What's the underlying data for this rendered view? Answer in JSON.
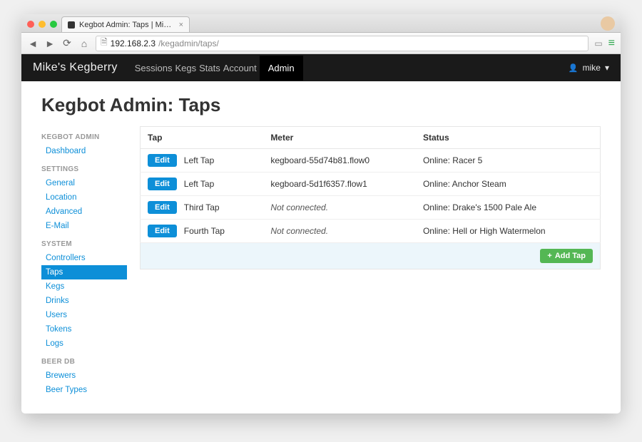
{
  "browser": {
    "tab_title": "Kegbot Admin: Taps | Mik…",
    "url_host": "192.168.2.3",
    "url_path": "/kegadmin/taps/"
  },
  "navbar": {
    "brand": "Mike's Kegberry",
    "items": [
      "Sessions",
      "Kegs",
      "Stats",
      "Account",
      "Admin"
    ],
    "active_index": 4,
    "user": "mike"
  },
  "page": {
    "title": "Kegbot Admin: Taps"
  },
  "sidebar": {
    "groups": [
      {
        "title": "KEGBOT ADMIN",
        "items": [
          "Dashboard"
        ]
      },
      {
        "title": "SETTINGS",
        "items": [
          "General",
          "Location",
          "Advanced",
          "E-Mail"
        ]
      },
      {
        "title": "SYSTEM",
        "items": [
          "Controllers",
          "Taps",
          "Kegs",
          "Drinks",
          "Users",
          "Tokens",
          "Logs"
        ]
      },
      {
        "title": "BEER DB",
        "items": [
          "Brewers",
          "Beer Types"
        ]
      }
    ],
    "active": "Taps"
  },
  "table": {
    "edit_label": "Edit",
    "add_label": "Add Tap",
    "columns": [
      "Tap",
      "Meter",
      "Status"
    ],
    "rows": [
      {
        "tap": "Left Tap",
        "meter": "kegboard-55d74b81.flow0",
        "meter_italic": false,
        "status": "Online: Racer 5"
      },
      {
        "tap": "Left Tap",
        "meter": "kegboard-5d1f6357.flow1",
        "meter_italic": false,
        "status": "Online: Anchor Steam"
      },
      {
        "tap": "Third Tap",
        "meter": "Not connected.",
        "meter_italic": true,
        "status": "Online: Drake's 1500 Pale Ale"
      },
      {
        "tap": "Fourth Tap",
        "meter": "Not connected.",
        "meter_italic": true,
        "status": "Online: Hell or High Watermelon"
      }
    ]
  }
}
